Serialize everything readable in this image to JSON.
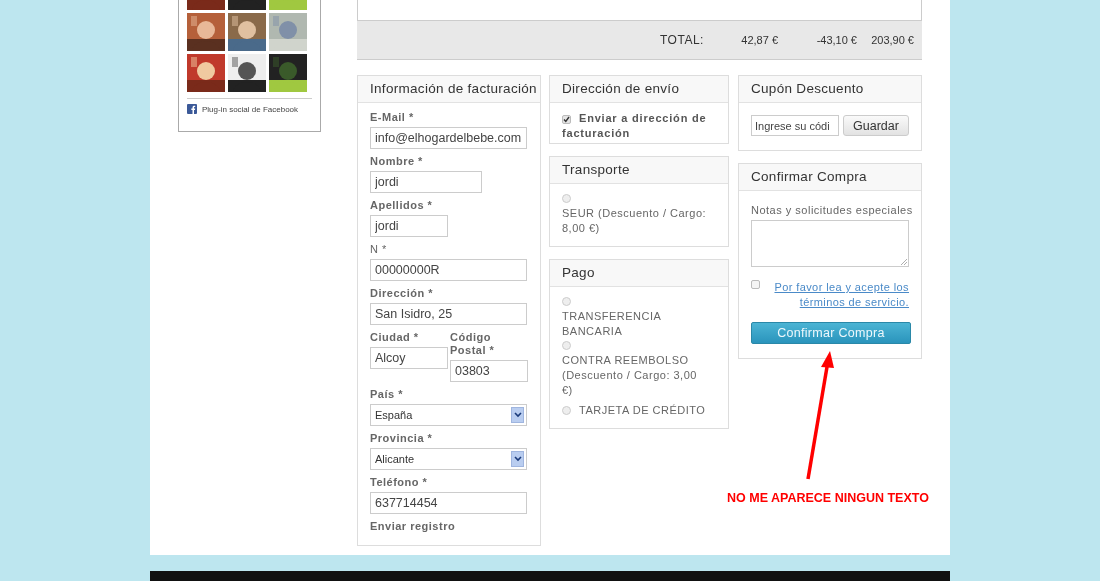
{
  "facebook_widget": {
    "caption": "Plug-in social de Facebook"
  },
  "order_total": {
    "label": "TOTAL:",
    "values": [
      "42,87 €",
      "-43,10 €",
      "203,90 €"
    ]
  },
  "billing": {
    "title": "Información de facturación",
    "fields": [
      {
        "kind": "text",
        "label": "E-Mail *",
        "bold": true,
        "value": "info@elhogardelbebe.com"
      },
      {
        "kind": "text",
        "label": "Nombre *",
        "bold": true,
        "value": "jordi"
      },
      {
        "kind": "text",
        "label": "Apellidos *",
        "bold": true,
        "value": "jordi"
      },
      {
        "kind": "text",
        "label": "N *",
        "bold": false,
        "value": "00000000R"
      },
      {
        "kind": "text",
        "label": "Dirección *",
        "bold": true,
        "value": "San Isidro, 25"
      },
      {
        "kind": "pair",
        "fields": [
          {
            "label": "Ciudad *",
            "bold": true,
            "value": "Alcoy"
          },
          {
            "label": "Código Postal *",
            "bold": true,
            "value": "03803"
          }
        ]
      },
      {
        "kind": "select",
        "label": "País *",
        "bold": true,
        "value": "España"
      },
      {
        "kind": "select",
        "label": "Provincia *",
        "bold": true,
        "value": "Alicante"
      },
      {
        "kind": "text",
        "label": "Teléfono *",
        "bold": true,
        "value": "637714454"
      },
      {
        "kind": "note",
        "label": "Enviar registro",
        "bold": true
      }
    ]
  },
  "shipping": {
    "title": "Dirección de envío",
    "checkbox": {
      "label": "Enviar a dirección de facturación",
      "checked": true
    }
  },
  "transport": {
    "title": "Transporte",
    "options": [
      {
        "label": "SEUR  (Descuento / Cargo: 8,00 €)",
        "selected": false
      }
    ]
  },
  "payment": {
    "title": "Pago",
    "options": [
      {
        "label": "TRANSFERENCIA BANCARIA",
        "selected": false
      },
      {
        "label": "CONTRA REEMBOLSO (Descuento / Cargo: 3,00 €)",
        "selected": false
      },
      {
        "label": "TARJETA DE CRÉDITO",
        "selected": false
      }
    ]
  },
  "coupon": {
    "title": "Cupón Descuento",
    "placeholder": "Ingrese su códi",
    "button": "Guardar"
  },
  "confirm": {
    "title": "Confirmar Compra",
    "notes_label": "Notas y solicitudes especiales",
    "terms": {
      "checked": false,
      "link": "Por favor lea y acepte los términos de servicio."
    },
    "button": "Confirmar Compra"
  },
  "annotation": {
    "text": "NO ME APARECE NINGUN TEXTO"
  }
}
